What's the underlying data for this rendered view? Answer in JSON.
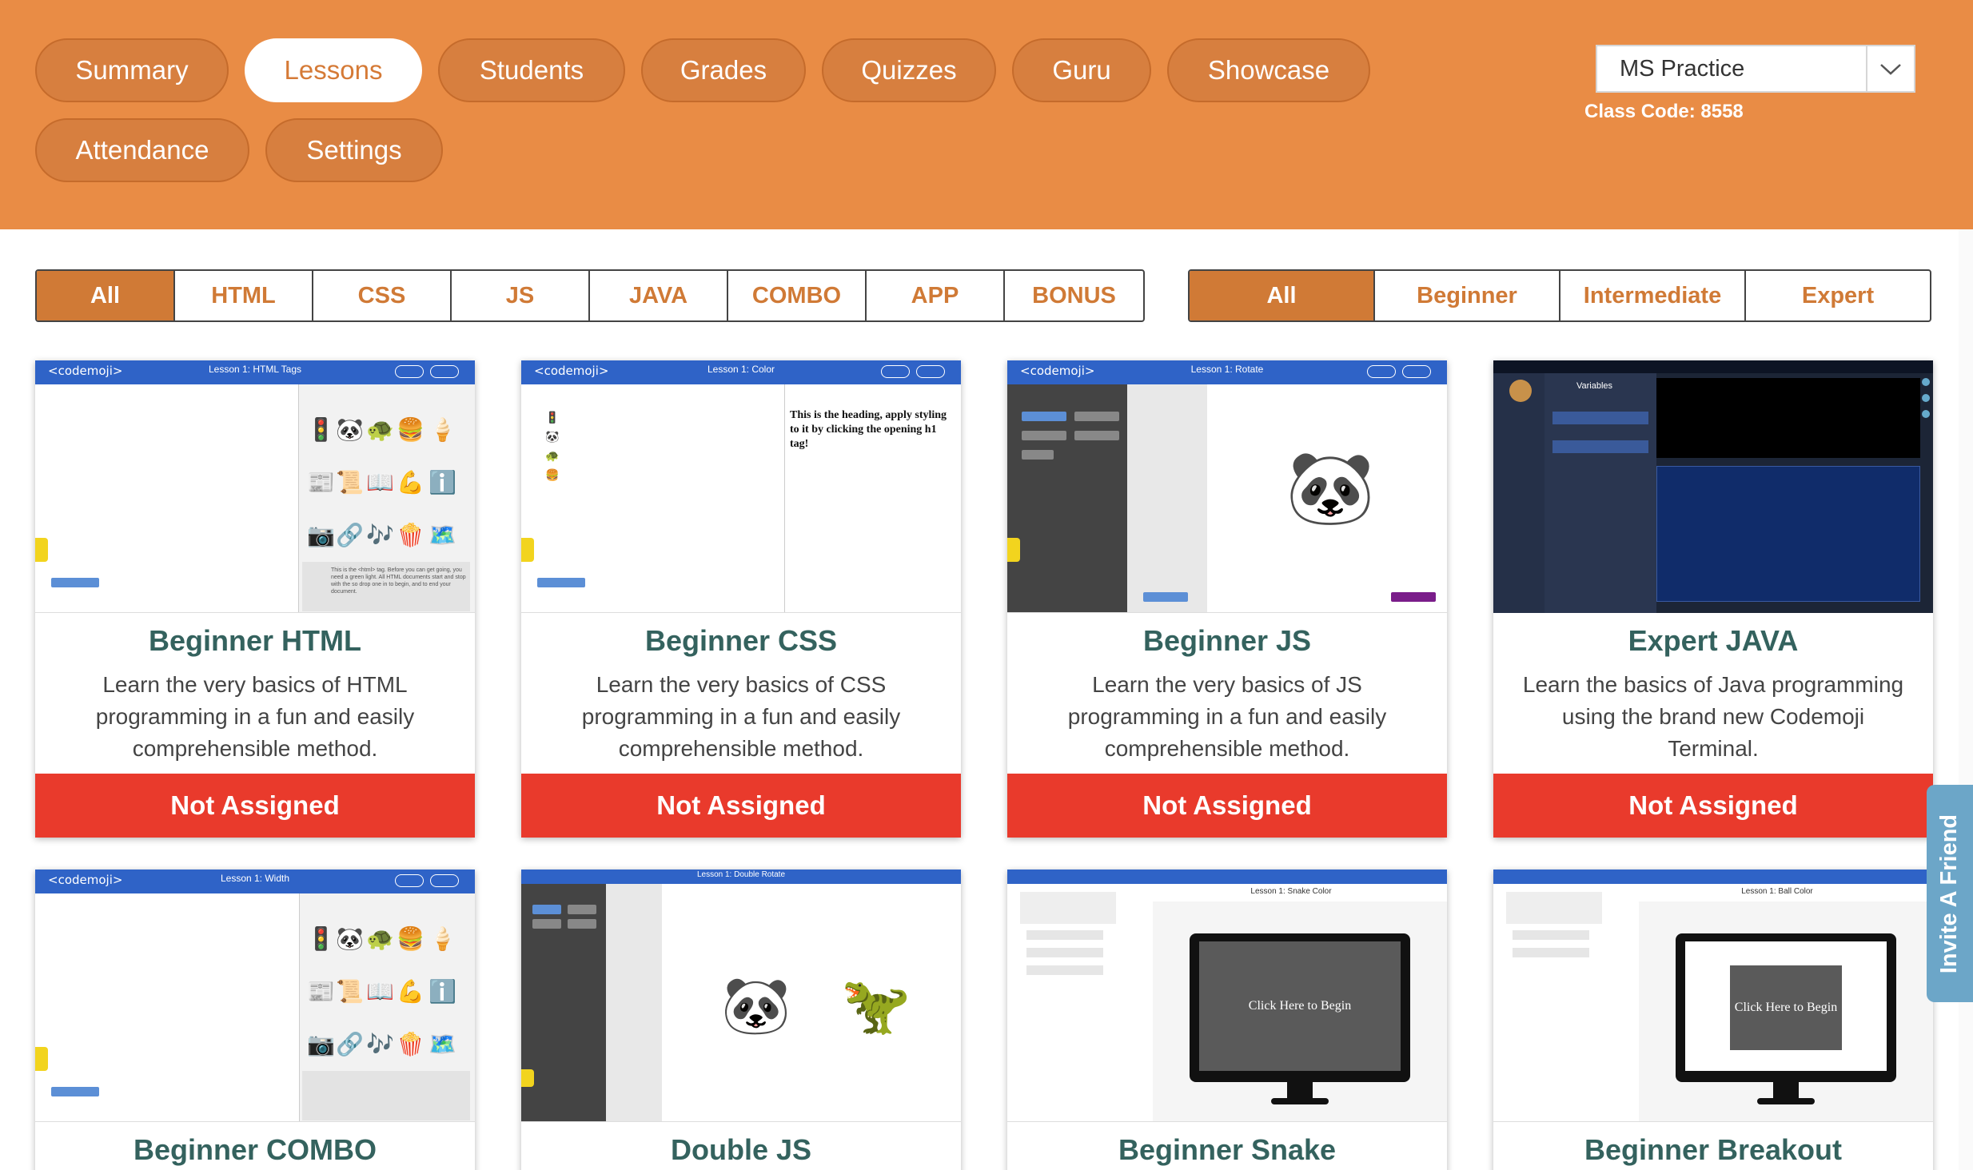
{
  "nav": {
    "tabs": [
      {
        "label": "Summary"
      },
      {
        "label": "Lessons",
        "active": true
      },
      {
        "label": "Students"
      },
      {
        "label": "Grades"
      },
      {
        "label": "Quizzes"
      },
      {
        "label": "Guru"
      },
      {
        "label": "Showcase"
      },
      {
        "label": "Attendance"
      },
      {
        "label": "Settings"
      }
    ]
  },
  "class_select": {
    "value": "MS Practice"
  },
  "class_code": "Class Code: 8558",
  "language_filter": {
    "items": [
      "All",
      "HTML",
      "CSS",
      "JS",
      "JAVA",
      "COMBO",
      "APP",
      "BONUS"
    ],
    "active": "All"
  },
  "level_filter": {
    "items": [
      "All",
      "Beginner",
      "Intermediate",
      "Expert"
    ],
    "active": "All"
  },
  "lessons": [
    {
      "title": "Beginner HTML",
      "description": "Learn the very basics of HTML programming in a fun and easily comprehensible method.",
      "status": "Not Assigned",
      "thumb_title": "Lesson 1: HTML Tags",
      "thumb_text": "This is the <html> tag. Before you can get going, you need a green light. All HTML documents start and stop with the  so drop one in to begin, and to end your document."
    },
    {
      "title": "Beginner CSS",
      "description": "Learn the very basics of CSS programming in a fun and easily comprehensible method.",
      "status": "Not Assigned",
      "thumb_title": "Lesson 1: Color",
      "thumb_text": "This is the heading, apply styling to it by clicking the opening h1 tag!"
    },
    {
      "title": "Beginner JS",
      "description": "Learn the very basics of JS programming in a fun and easily comprehensible method.",
      "status": "Not Assigned",
      "thumb_title": "Lesson 1: Rotate"
    },
    {
      "title": "Expert JAVA",
      "description": "Learn the basics of Java programming using the brand new Codemoji Terminal.",
      "status": "Not Assigned",
      "thumb_title": "Variables"
    },
    {
      "title": "Beginner COMBO",
      "thumb_title": "Lesson 1: Width"
    },
    {
      "title": "Double JS",
      "thumb_title": "Lesson 1: Double Rotate"
    },
    {
      "title": "Beginner Snake",
      "thumb_title": "Lesson 1: Snake Color",
      "thumb_screen": "Click Here to Begin"
    },
    {
      "title": "Beginner Breakout",
      "thumb_title": "Lesson 1: Ball Color",
      "thumb_screen": "Click Here to Begin"
    }
  ],
  "invite_label": "Invite A Friend",
  "colors": {
    "header": "#e98c45",
    "accent": "#d07a36",
    "not_assigned": "#e93a2c",
    "title": "#34625e",
    "invite": "#6ca6c8"
  }
}
